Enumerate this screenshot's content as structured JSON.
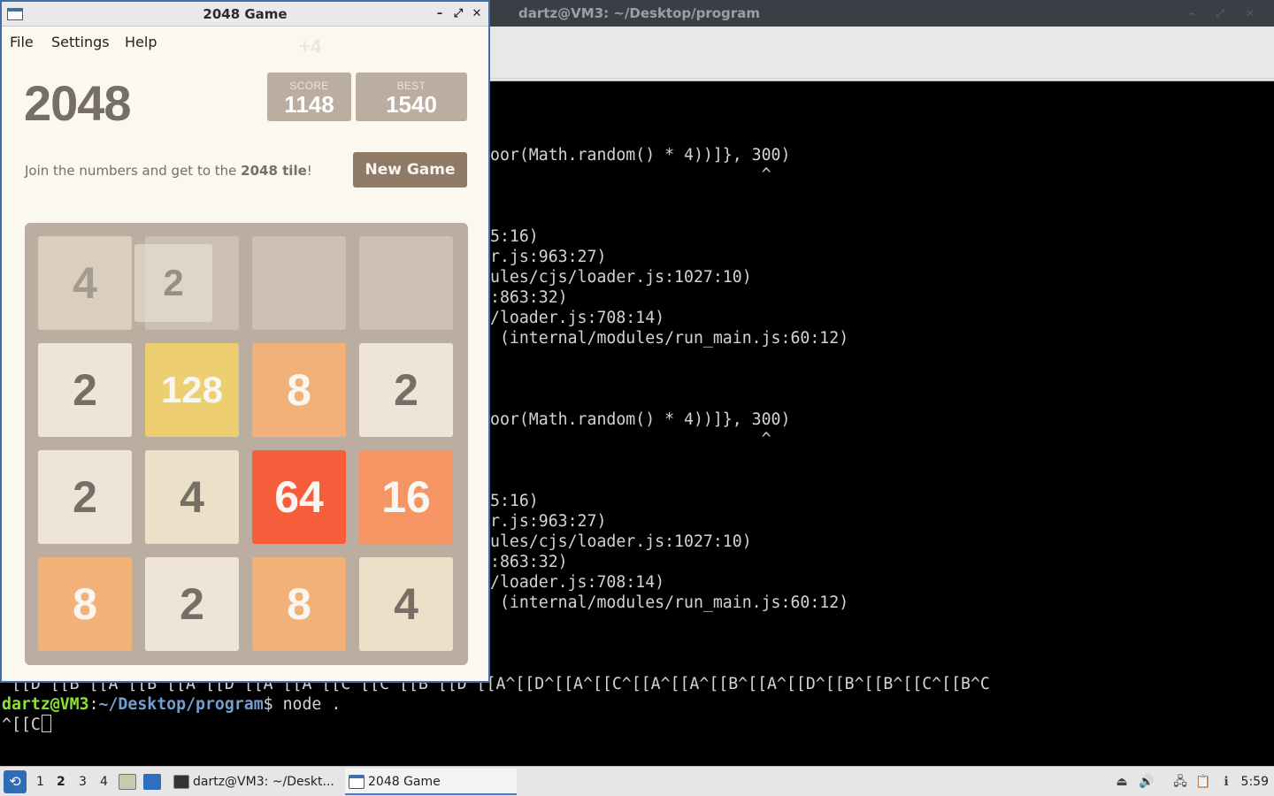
{
  "terminal": {
    "title": "dartz@VM3: ~/Desktop/program",
    "lines": [
      "oor(Math.random() * 4))]}, 300)",
      "                            ^",
      "5:16)",
      "r.js:963:27)",
      "ules/cjs/loader.js:1027:10)",
      ":863:32)",
      "/loader.js:708:14)",
      " (internal/modules/run_main.js:60:12)",
      "oor(Math.random() * 4))]}, 300)",
      "                            ^",
      "5:16)",
      "r.js:963:27)",
      "ules/cjs/loader.js:1027:10)",
      ":863:32)",
      "/loader.js:708:14)",
      " (internal/modules/run_main.js:60:12)"
    ],
    "escape_line": "^[[D^[[B^[[A^[[B^[[A^[[D^[[A^[[A^[[C^[[C^[[B^[[D^[[A^[[D^[[A^[[C^[[A^[[A^[[B^[[A^[[D^[[B^[[B^[[C^[[B^C",
    "prompt_user": "dartz@VM3",
    "prompt_sep": ":",
    "prompt_path": "~/Desktop/program",
    "prompt_dollar": "$ ",
    "command": "node .",
    "input_line": "^[[C"
  },
  "game_window": {
    "title": "2048 Game",
    "minimize_glyph": "–",
    "maximize_glyph": "⤢",
    "close_glyph": "✕",
    "menu": [
      "File",
      "Settings",
      "Help"
    ],
    "ghost_score_add": "+4"
  },
  "game": {
    "title": "2048",
    "score_label": "SCORE",
    "score": "1148",
    "best_label": "BEST",
    "best": "1540",
    "intro_prefix": "Join the numbers and get to the ",
    "intro_bold": "2048 tile",
    "intro_suffix": "!",
    "new_game_label": "New Game",
    "ghost_tile": "2",
    "board": [
      [
        4,
        0,
        0,
        0
      ],
      [
        2,
        128,
        8,
        2
      ],
      [
        2,
        4,
        64,
        16
      ],
      [
        8,
        2,
        8,
        4
      ]
    ],
    "faded_cells": [
      [
        0,
        0
      ]
    ]
  },
  "taskbar": {
    "desktops": [
      "1",
      "2",
      "3",
      "4"
    ],
    "active_desktop": "2",
    "tasks": [
      {
        "label": "dartz@VM3: ~/Deskt...",
        "icon": "terminal-icon"
      },
      {
        "label": "2048 Game",
        "icon": "window-icon"
      }
    ],
    "clock": "5:59"
  },
  "colors": {
    "terminal_bg": "#000000",
    "prompt_user": "#8ae234",
    "prompt_path": "#729fcf",
    "game_bg": "#faf8ef",
    "grid_bg": "#bbada0",
    "accent": "#3b7fd6"
  }
}
